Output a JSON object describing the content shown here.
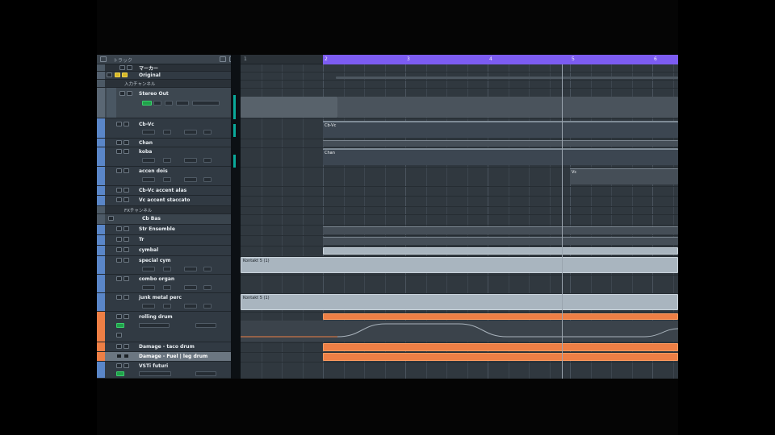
{
  "window": {
    "header_label": "トラック"
  },
  "ruler": {
    "left_bar": "1",
    "bars": [
      "2",
      "3",
      "4",
      "5",
      "6"
    ]
  },
  "tracks": [
    {
      "id": "marker",
      "name": "マーカー",
      "kind": "folder"
    },
    {
      "id": "original",
      "name": "Original",
      "kind": "track"
    },
    {
      "id": "input-channels-folder",
      "name": "入力チャンネル",
      "kind": "subfolder"
    },
    {
      "id": "stereo-out",
      "name": "Stereo Out",
      "kind": "output"
    },
    {
      "id": "cb-vc",
      "name": "Cb-Vc",
      "kind": "track"
    },
    {
      "id": "chan",
      "name": "Chan",
      "kind": "track"
    },
    {
      "id": "kobo",
      "name": "koba",
      "kind": "track"
    },
    {
      "id": "accen-dois",
      "name": "accen dois",
      "kind": "track"
    },
    {
      "id": "cb-vc-accent-alas",
      "name": "Cb-Vc accent alas",
      "kind": "track"
    },
    {
      "id": "vc-accent-staccato",
      "name": "Vc accent staccato",
      "kind": "track"
    },
    {
      "id": "fx-folder",
      "name": "FXチャンネル",
      "kind": "subfolder"
    },
    {
      "id": "cb-bas",
      "name": "Cb Bas",
      "kind": "track"
    },
    {
      "id": "str-ensemble",
      "name": "Str Ensemble",
      "kind": "track"
    },
    {
      "id": "tr",
      "name": "Tr",
      "kind": "track"
    },
    {
      "id": "cymbal",
      "name": "cymbal",
      "kind": "track"
    },
    {
      "id": "special-cym",
      "name": "special cym",
      "kind": "track"
    },
    {
      "id": "combo-organ",
      "name": "combo organ",
      "kind": "track"
    },
    {
      "id": "junk-metal-perc",
      "name": "junk metal perc",
      "kind": "track"
    },
    {
      "id": "rolling-drum",
      "name": "rolling drum",
      "kind": "track"
    },
    {
      "id": "damage-taco-drum",
      "name": "Damage - taco drum",
      "kind": "track"
    },
    {
      "id": "damage-fuel-leg-drum",
      "name": "Damage - Fuel | leg drum",
      "kind": "track"
    },
    {
      "id": "vst-inst",
      "name": "VSTi futuri",
      "kind": "track"
    }
  ],
  "clips": {
    "cb_vc": "Cb-Vc",
    "chan": "Chan",
    "kobo": "Chan",
    "accen": "Vc",
    "special_cym": "Kontakt 5 (1)",
    "junk_metal": "Kontakt 5 (1)"
  },
  "colors": {
    "ruler": "#7c5cf2",
    "orange_clip": "#ee7f45",
    "gray_clip": "#a9b5bf",
    "meter": "#0aa99a",
    "selected_track": "#6b7681"
  }
}
